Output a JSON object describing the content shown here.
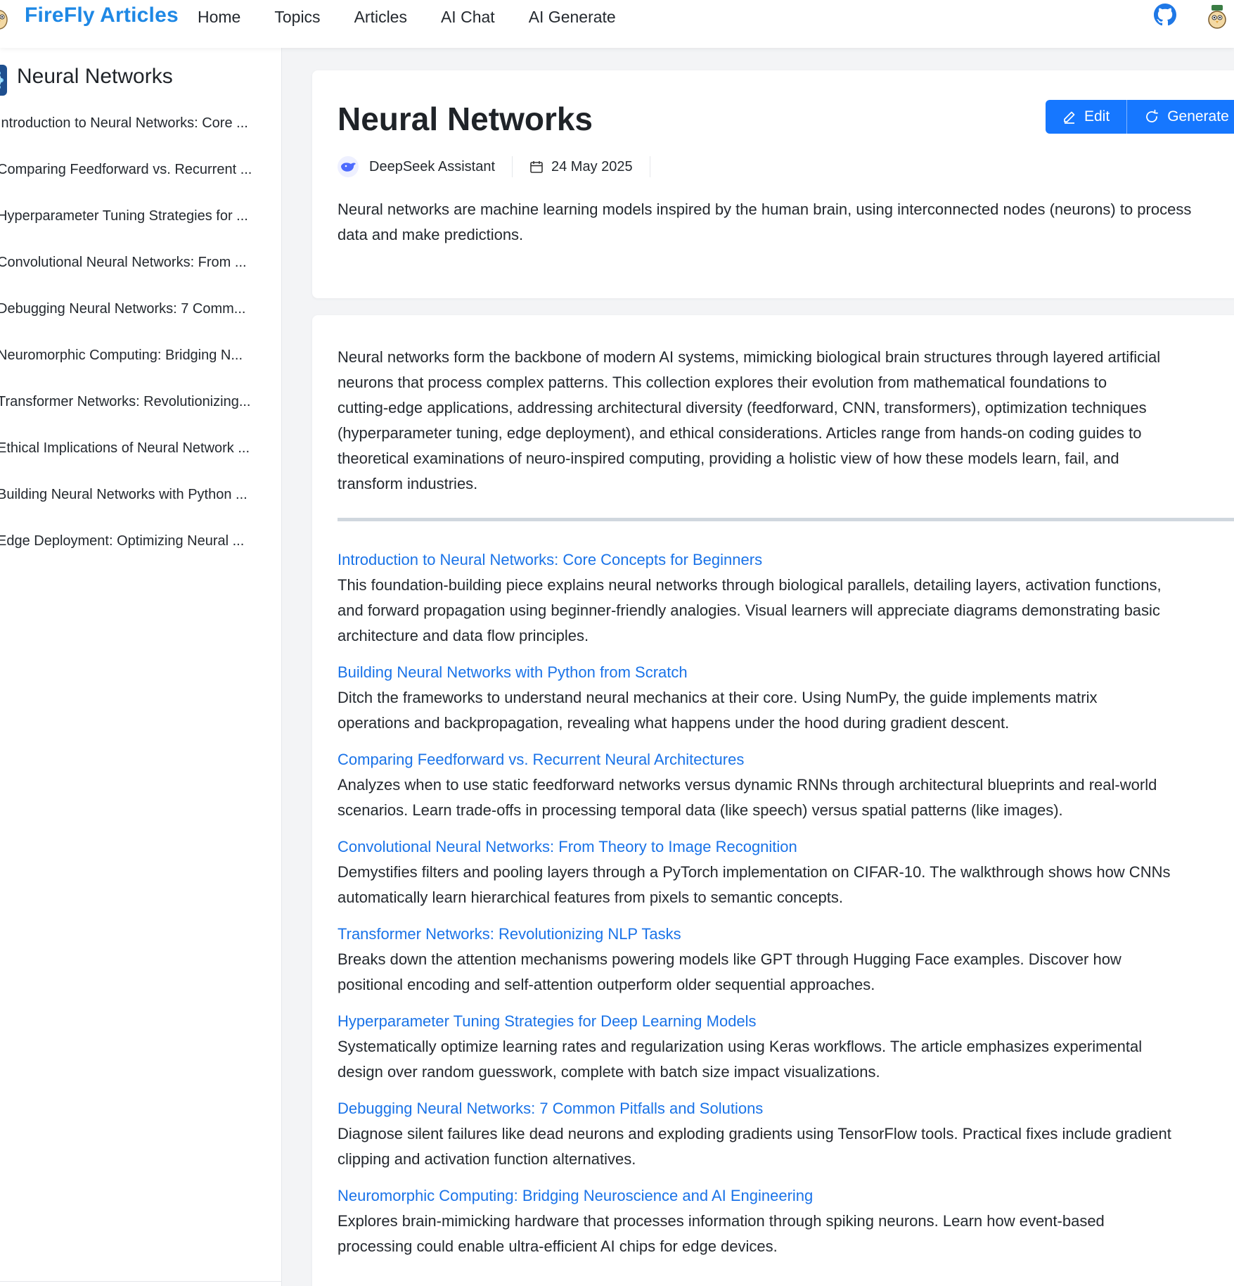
{
  "nav": {
    "brand": "FireFly Articles",
    "links": [
      "Home",
      "Topics",
      "Articles",
      "AI Chat",
      "AI Generate"
    ]
  },
  "sidebar": {
    "title": "Neural Networks",
    "items": [
      "Introduction to Neural Networks: Core ...",
      "Comparing Feedforward vs. Recurrent ...",
      "Hyperparameter Tuning Strategies for ...",
      "Convolutional Neural Networks: From ...",
      "Debugging Neural Networks: 7 Comm...",
      "Neuromorphic Computing: Bridging N...",
      "Transformer Networks: Revolutionizing...",
      "Ethical Implications of Neural Network ...",
      "Building Neural Networks with Python ...",
      "Edge Deployment: Optimizing Neural ..."
    ]
  },
  "header": {
    "title": "Neural Networks",
    "edit_label": "Edit",
    "generate_label": "Generate",
    "author": "DeepSeek Assistant",
    "date": "24 May 2025",
    "summary": "Neural networks are machine learning models inspired by the human brain, using interconnected nodes (neurons) to process data and make predictions."
  },
  "intro_lines": [
    "Neural networks form the backbone of modern AI systems, mimicking biological brain structures through layered artificial",
    "neurons that process complex patterns. This collection explores their evolution from mathematical foundations to",
    "cutting-edge applications, addressing architectural diversity (feedforward, CNN, transformers), optimization techniques",
    "(hyperparameter tuning, edge deployment), and ethical considerations. Articles range from hands-on coding guides to",
    "theoretical examinations of neuro-inspired computing, providing a holistic view of how these models learn, fail, and",
    "transform industries."
  ],
  "articles": [
    {
      "title": "Introduction to Neural Networks: Core Concepts for Beginners",
      "lines": [
        "This foundation-building piece explains neural networks through biological parallels, detailing layers, activation functions,",
        "and forward propagation using beginner-friendly analogies. Visual learners will appreciate diagrams demonstrating basic",
        "architecture and data flow principles."
      ]
    },
    {
      "title": "Building Neural Networks with Python from Scratch",
      "lines": [
        "Ditch the frameworks to understand neural mechanics at their core. Using NumPy, the guide implements matrix",
        "operations and backpropagation, revealing what happens under the hood during gradient descent."
      ]
    },
    {
      "title": "Comparing Feedforward vs. Recurrent Neural Architectures",
      "lines": [
        "Analyzes when to use static feedforward networks versus dynamic RNNs through architectural blueprints and real-world",
        "scenarios. Learn trade-offs in processing temporal data (like speech) versus spatial patterns (like images)."
      ]
    },
    {
      "title": "Convolutional Neural Networks: From Theory to Image Recognition",
      "lines": [
        "Demystifies filters and pooling layers through a PyTorch implementation on CIFAR-10. The walkthrough shows how CNNs",
        "automatically learn hierarchical features from pixels to semantic concepts."
      ]
    },
    {
      "title": "Transformer Networks: Revolutionizing NLP Tasks",
      "lines": [
        "Breaks down the attention mechanisms powering models like GPT through Hugging Face examples. Discover how",
        "positional encoding and self-attention outperform older sequential approaches."
      ]
    },
    {
      "title": "Hyperparameter Tuning Strategies for Deep Learning Models",
      "lines": [
        "Systematically optimize learning rates and regularization using Keras workflows. The article emphasizes experimental",
        "design over random guesswork, complete with batch size impact visualizations."
      ]
    },
    {
      "title": "Debugging Neural Networks: 7 Common Pitfalls and Solutions",
      "lines": [
        "Diagnose silent failures like dead neurons and exploding gradients using TensorFlow tools. Practical fixes include gradient",
        "clipping and activation function alternatives."
      ]
    },
    {
      "title": "Neuromorphic Computing: Bridging Neuroscience and AI Engineering",
      "lines": [
        "Explores brain-mimicking hardware that processes information through spiking neurons. Learn how event-based",
        "processing could enable ultra-efficient AI chips for edge devices."
      ]
    }
  ],
  "colors": {
    "brand": "#1e88e5",
    "link": "#1a73e8",
    "button": "#1677ff"
  },
  "icons": {
    "logo": "owl-mascot-icon",
    "github": "github-icon",
    "avatar": "user-avatar-icon",
    "topic": "brain-network-icon",
    "edit": "pencil-icon",
    "generate": "refresh-icon",
    "author": "deepseek-whale-icon",
    "date": "calendar-icon"
  }
}
